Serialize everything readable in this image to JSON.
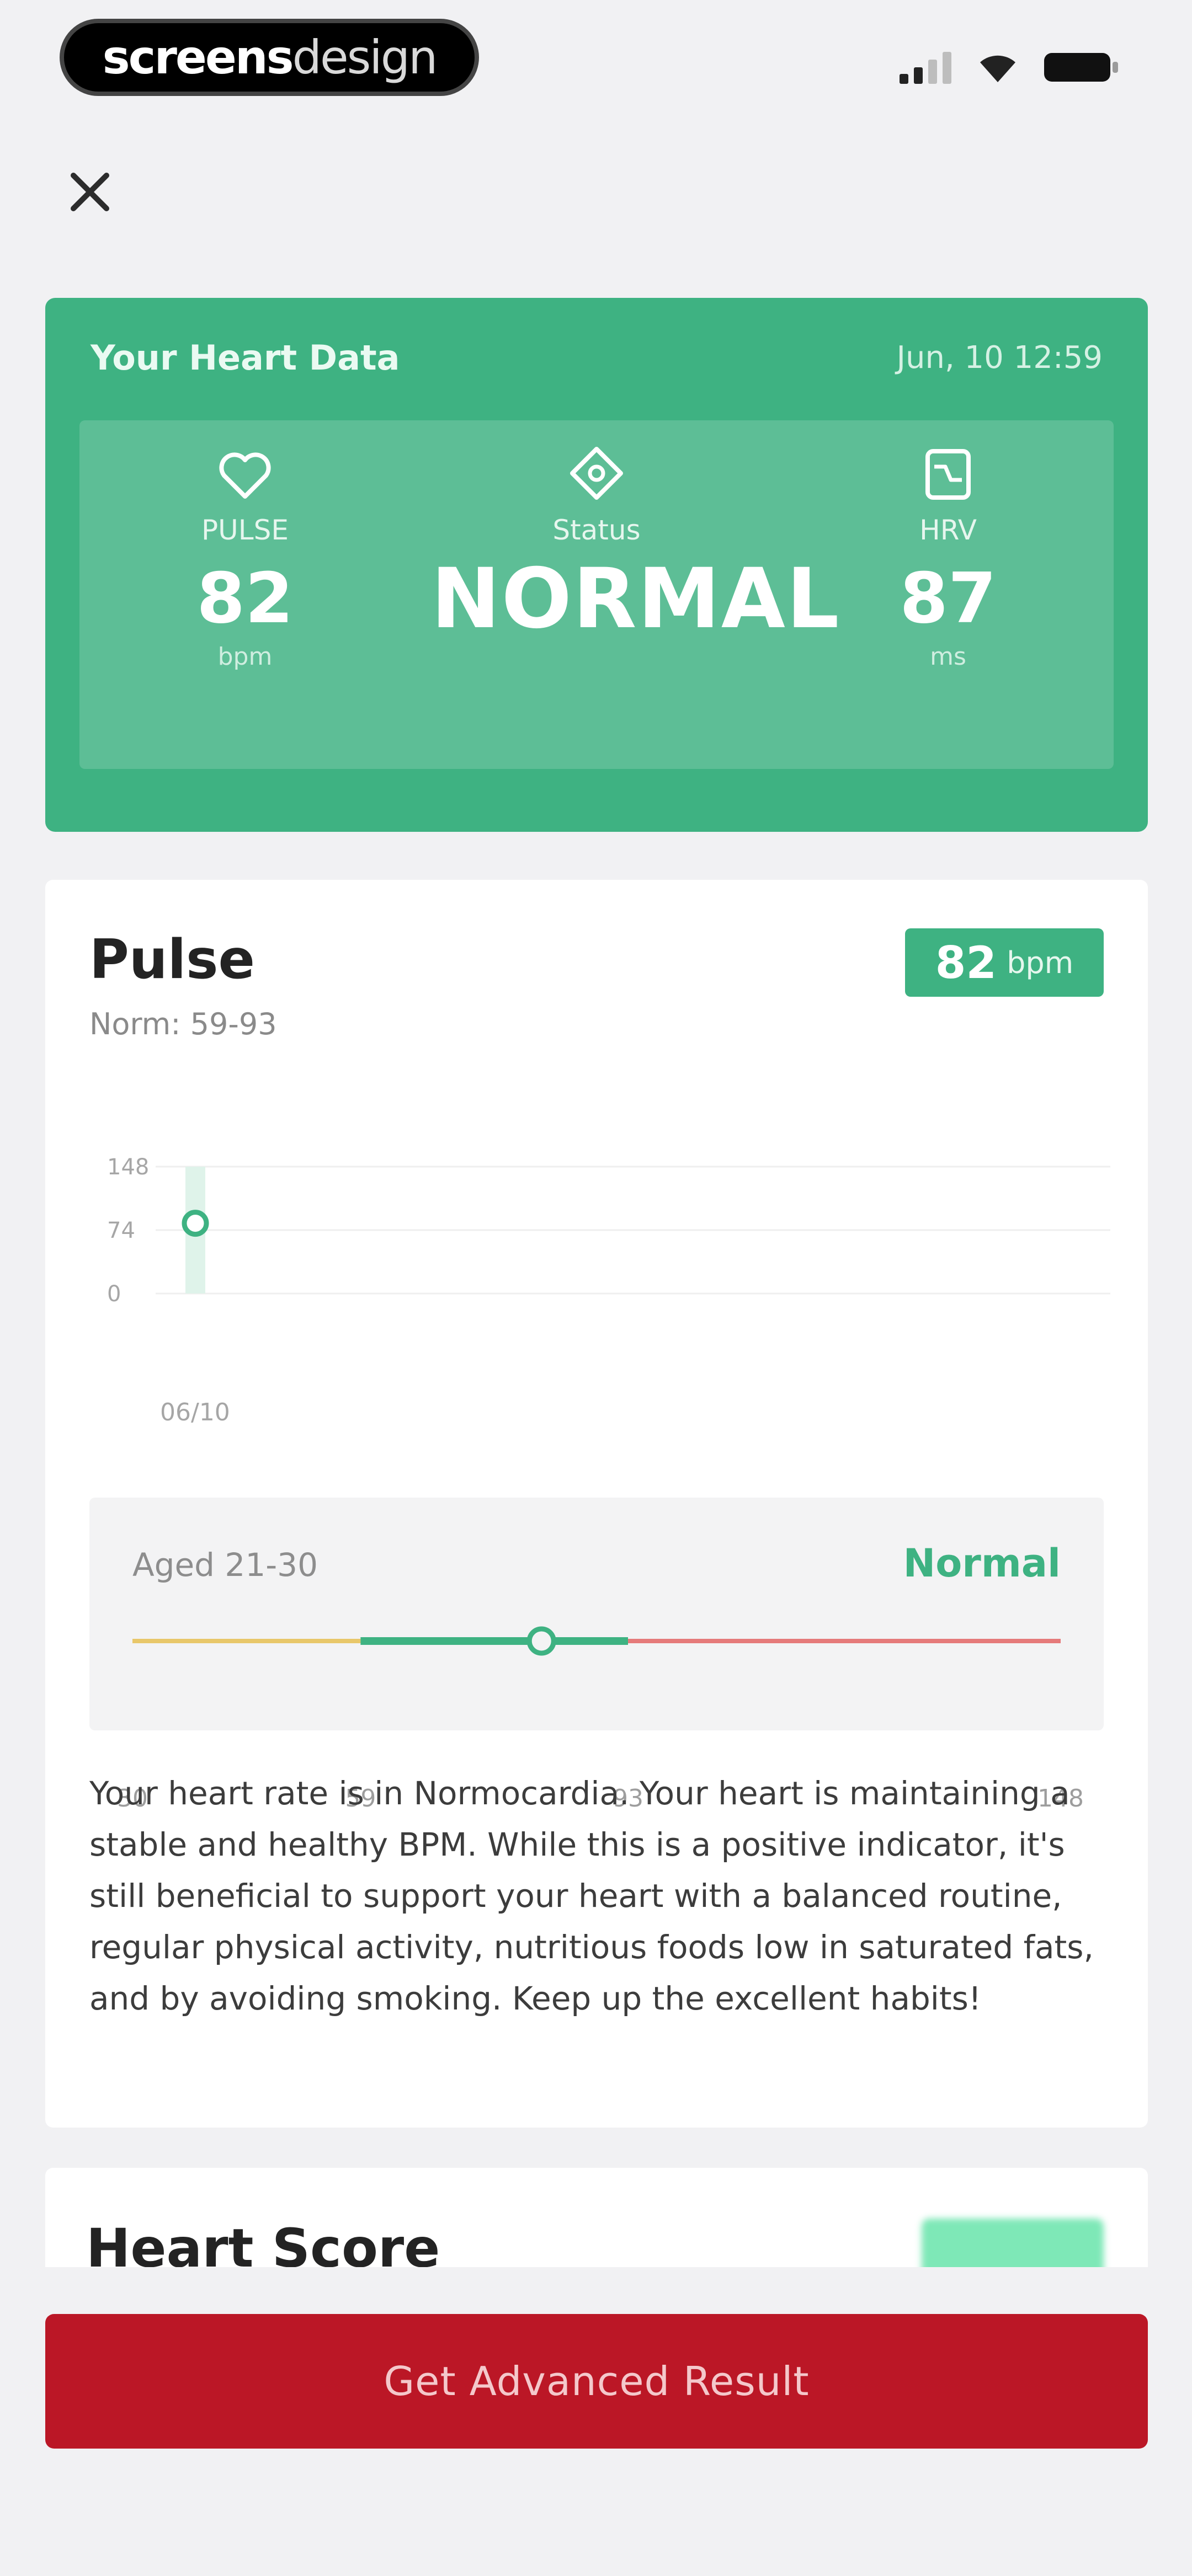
{
  "status_bar": {
    "brand_part1": "screens",
    "brand_part2": "design",
    "icons": [
      "signal-icon",
      "wifi-icon",
      "battery-icon"
    ]
  },
  "heart_data": {
    "title": "Your Heart Data",
    "datetime": "Jun, 10 12:59",
    "metrics": [
      {
        "icon": "heart-icon",
        "label": "PULSE",
        "value": "82",
        "unit": "bpm"
      },
      {
        "icon": "diamond-icon",
        "label": "Status",
        "value": "NORMAL",
        "unit": ""
      },
      {
        "icon": "hrv-icon",
        "label": "HRV",
        "value": "87",
        "unit": "ms"
      }
    ]
  },
  "pulse": {
    "title": "Pulse",
    "norm": "Norm: 59-93",
    "badge_value": "82",
    "badge_unit": "bpm",
    "chart_data": {
      "type": "scatter",
      "x": [
        "06/10"
      ],
      "y": [
        82
      ],
      "ylim": [
        0,
        148
      ],
      "y_ticks": [
        148,
        74,
        0
      ],
      "grid": true
    },
    "range": {
      "age": "Aged 21-30",
      "status": "Normal",
      "ticks": [
        30,
        59,
        93,
        148
      ],
      "marker_value": 82,
      "colors": {
        "low": "#e8c76a",
        "normal": "#3eb282",
        "high": "#e57a7a"
      }
    },
    "description": "Your heart rate is in Normocardia. Your heart is maintaining a stable and healthy BPM. While this is a positive indicator, it's still beneficial to support your heart with a balanced routine, regular physical activity, nutritious foods low in saturated fats, and by avoiding smoking. Keep up the excellent habits!"
  },
  "heart_score": {
    "title": "Heart Score"
  },
  "cta": {
    "label": "Get Advanced Result"
  },
  "colors": {
    "accent": "#3eb282",
    "cta": "#bb1726",
    "background": "#f1f1f3"
  }
}
